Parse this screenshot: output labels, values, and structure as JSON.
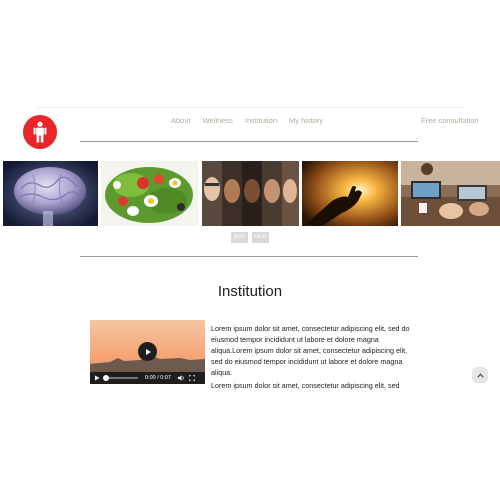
{
  "header": {
    "logo": {
      "icon": "person-icon",
      "color": "#e8262b"
    },
    "nav": [
      {
        "label": "About"
      },
      {
        "label": "Wellness"
      },
      {
        "label": "Institution"
      },
      {
        "label": "My history"
      }
    ],
    "consultation_label": "Free consultation"
  },
  "carousel": {
    "slides": [
      {
        "name": "brain-image"
      },
      {
        "name": "salad-image"
      },
      {
        "name": "faces-image"
      },
      {
        "name": "sunset-hands-image"
      },
      {
        "name": "laptop-workers-image"
      }
    ],
    "prev_label": "prev",
    "next_label": "next"
  },
  "section": {
    "title": "Institution"
  },
  "video": {
    "time": "0:00 / 0:07",
    "progress": 0
  },
  "content": {
    "paragraphs": [
      "Lorem ipsum dolor sit amet, consectetur adipiscing elit, sed do eiusmod tempor incididunt ut labore et dolore magna aliqua.Lorem ipsum dolor sit amet, consectetur adipiscing elit, sed do eiusmod tempor incididunt ut labore et dolore magna aliqua.",
      "Lorem ipsum dolor sit amet, consectetur adipiscing elit, sed"
    ]
  },
  "colors": {
    "accent_red": "#e8262b",
    "nav_text": "#b3a99a",
    "pager_bg": "#d9d9d9"
  },
  "scroll_top": {
    "icon": "chevron-up-icon"
  }
}
